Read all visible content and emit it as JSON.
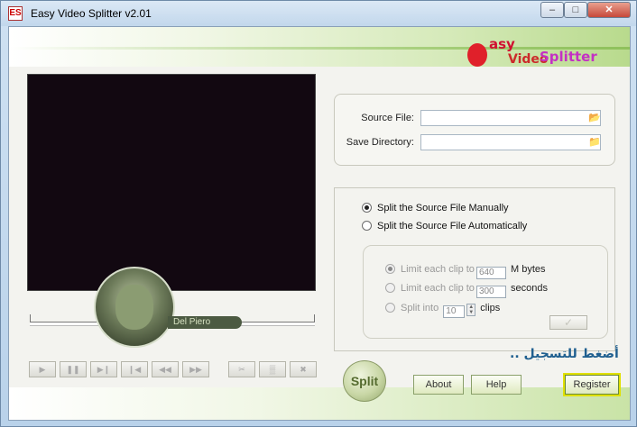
{
  "window": {
    "title": "Easy Video Splitter v2.01",
    "app_icon_text": "ES",
    "min_glyph": "–",
    "max_glyph": "□",
    "close_glyph": "✕"
  },
  "logo": {
    "word_easy": "asy",
    "word_video": "Video",
    "word_splitter": "Splitter"
  },
  "player": {
    "avatar_caption": "Del Piero",
    "controls": [
      "▶",
      "❚❚",
      "▶❙",
      "❙◀",
      "◀◀",
      "▶▶"
    ],
    "clip_controls": [
      "✂",
      "▒",
      "✖"
    ]
  },
  "files": {
    "source_label": "Source File:",
    "source_value": "",
    "save_label": "Save Directory:",
    "save_value": ""
  },
  "mode": {
    "manual_label": "Split the Source File Manually",
    "auto_label": "Split the Source File Automatically",
    "selected": "manual",
    "limit_size_label": "Limit each clip to",
    "limit_size_value": "640",
    "limit_size_unit": "M bytes",
    "limit_time_label": "Limit each clip to",
    "limit_time_value": "300",
    "limit_time_unit": "seconds",
    "split_into_label": "Split into",
    "split_into_value": "10",
    "split_into_unit": "clips",
    "ok_glyph": "✓"
  },
  "actions": {
    "split": "Split",
    "about": "About",
    "help": "Help",
    "register": "Register",
    "arabic_note": "أضغط للتسجيل .."
  },
  "colors": {
    "accent_green": "#b8da8c",
    "register_highlight": "#e0e000"
  }
}
